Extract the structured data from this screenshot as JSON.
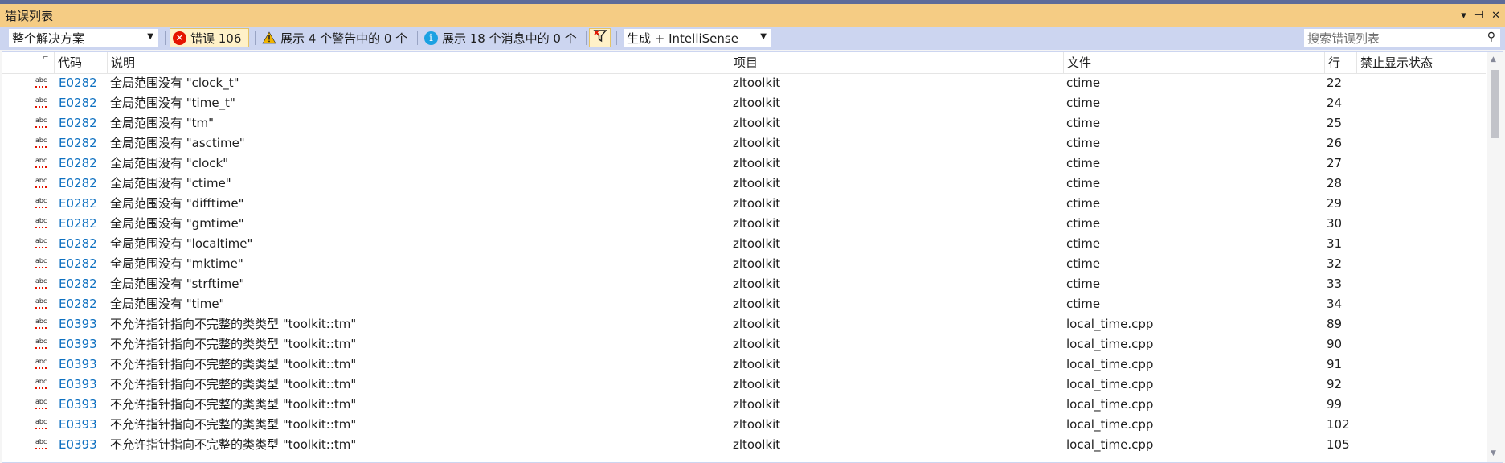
{
  "window": {
    "title": "错误列表"
  },
  "title_buttons": {
    "dropdown": "▾",
    "pin": "⊣",
    "close": "✕"
  },
  "toolbar": {
    "scope": "整个解决方案",
    "errors_label": "错误 106",
    "warnings_label": "展示 4 个警告中的 0 个",
    "messages_label": "展示 18 个消息中的 0 个",
    "build_source": "生成 + IntelliSense",
    "search_placeholder": "搜索错误列表"
  },
  "columns": {
    "code": "代码",
    "description": "说明",
    "project": "项目",
    "file": "文件",
    "line": "行",
    "suppression": "禁止显示状态"
  },
  "rows": [
    {
      "code": "E0282",
      "description": "全局范围没有 \"clock_t\"",
      "project": "zltoolkit",
      "file": "ctime",
      "line": "22"
    },
    {
      "code": "E0282",
      "description": "全局范围没有 \"time_t\"",
      "project": "zltoolkit",
      "file": "ctime",
      "line": "24"
    },
    {
      "code": "E0282",
      "description": "全局范围没有 \"tm\"",
      "project": "zltoolkit",
      "file": "ctime",
      "line": "25"
    },
    {
      "code": "E0282",
      "description": "全局范围没有 \"asctime\"",
      "project": "zltoolkit",
      "file": "ctime",
      "line": "26"
    },
    {
      "code": "E0282",
      "description": "全局范围没有 \"clock\"",
      "project": "zltoolkit",
      "file": "ctime",
      "line": "27"
    },
    {
      "code": "E0282",
      "description": "全局范围没有 \"ctime\"",
      "project": "zltoolkit",
      "file": "ctime",
      "line": "28"
    },
    {
      "code": "E0282",
      "description": "全局范围没有 \"difftime\"",
      "project": "zltoolkit",
      "file": "ctime",
      "line": "29"
    },
    {
      "code": "E0282",
      "description": "全局范围没有 \"gmtime\"",
      "project": "zltoolkit",
      "file": "ctime",
      "line": "30"
    },
    {
      "code": "E0282",
      "description": "全局范围没有 \"localtime\"",
      "project": "zltoolkit",
      "file": "ctime",
      "line": "31"
    },
    {
      "code": "E0282",
      "description": "全局范围没有 \"mktime\"",
      "project": "zltoolkit",
      "file": "ctime",
      "line": "32"
    },
    {
      "code": "E0282",
      "description": "全局范围没有 \"strftime\"",
      "project": "zltoolkit",
      "file": "ctime",
      "line": "33"
    },
    {
      "code": "E0282",
      "description": "全局范围没有 \"time\"",
      "project": "zltoolkit",
      "file": "ctime",
      "line": "34"
    },
    {
      "code": "E0393",
      "description": "不允许指针指向不完整的类类型 \"toolkit::tm\"",
      "project": "zltoolkit",
      "file": "local_time.cpp",
      "line": "89"
    },
    {
      "code": "E0393",
      "description": "不允许指针指向不完整的类类型 \"toolkit::tm\"",
      "project": "zltoolkit",
      "file": "local_time.cpp",
      "line": "90"
    },
    {
      "code": "E0393",
      "description": "不允许指针指向不完整的类类型 \"toolkit::tm\"",
      "project": "zltoolkit",
      "file": "local_time.cpp",
      "line": "91"
    },
    {
      "code": "E0393",
      "description": "不允许指针指向不完整的类类型 \"toolkit::tm\"",
      "project": "zltoolkit",
      "file": "local_time.cpp",
      "line": "92"
    },
    {
      "code": "E0393",
      "description": "不允许指针指向不完整的类类型 \"toolkit::tm\"",
      "project": "zltoolkit",
      "file": "local_time.cpp",
      "line": "99"
    },
    {
      "code": "E0393",
      "description": "不允许指针指向不完整的类类型 \"toolkit::tm\"",
      "project": "zltoolkit",
      "file": "local_time.cpp",
      "line": "102"
    },
    {
      "code": "E0393",
      "description": "不允许指针指向不完整的类类型 \"toolkit::tm\"",
      "project": "zltoolkit",
      "file": "local_time.cpp",
      "line": "105"
    }
  ],
  "icons": {
    "row_icon": "spell-check-icon",
    "error": "error-circle-icon",
    "warning": "warning-triangle-icon",
    "info": "info-circle-icon",
    "filter": "filter-icon",
    "search": "search-icon"
  },
  "colors": {
    "title_bar": "#f5cc84",
    "toolbar": "#ccd5f0",
    "link": "#0e70c0",
    "error": "#e51400"
  }
}
